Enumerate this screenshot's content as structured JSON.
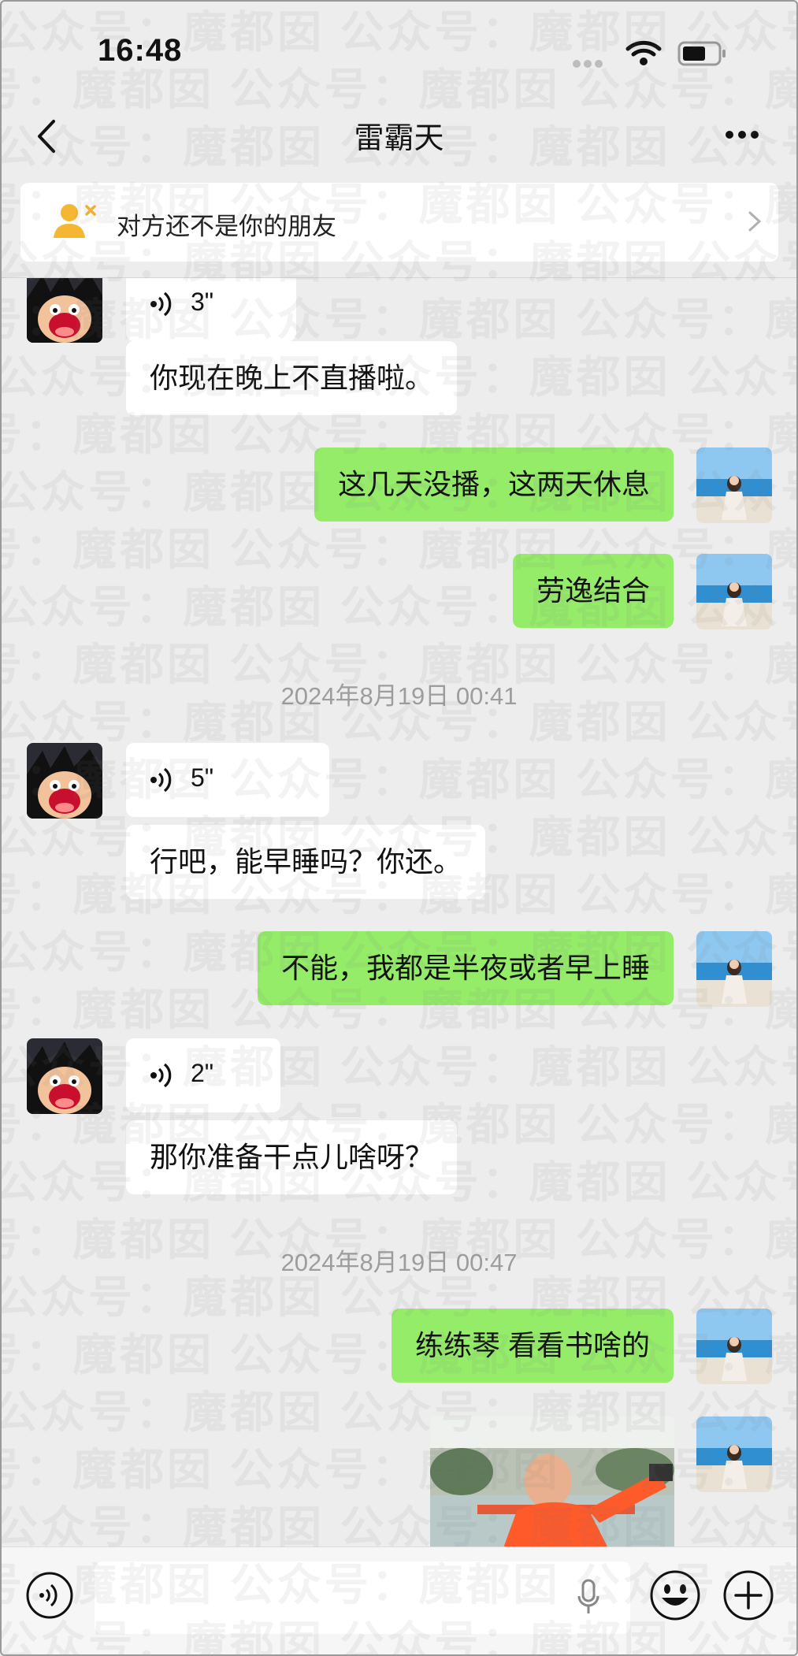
{
  "status_bar": {
    "time": "16:48"
  },
  "nav": {
    "title": "雷霸天"
  },
  "notice": {
    "text": "对方还不是你的朋友"
  },
  "messages": {
    "m1": {
      "duration": "3\""
    },
    "m2": {
      "text": "你现在晚上不直播啦。"
    },
    "m3": {
      "text": "这几天没播，这两天休息"
    },
    "m4": {
      "text": "劳逸结合"
    },
    "t1": {
      "text": "2024年8月19日 00:41"
    },
    "m5": {
      "duration": "5\""
    },
    "m6": {
      "text": "行吧，能早睡吗？你还。"
    },
    "m7": {
      "text": "不能，我都是半夜或者早上睡"
    },
    "m8": {
      "duration": "2\""
    },
    "m9": {
      "text": "那你准备干点儿啥呀？"
    },
    "t2": {
      "text": "2024年8月19日 00:47"
    },
    "m10": {
      "text": "练练琴 看看书啥的"
    }
  },
  "watermark": {
    "text": "公众号：魔都囡"
  },
  "colors": {
    "outgoing_bubble": "#95ec69",
    "incoming_bubble": "#ffffff",
    "background": "#ededed"
  },
  "icons": [
    "back-icon",
    "more-icon",
    "stranger-icon",
    "chevron-right-icon",
    "voice-wave-icon",
    "mic-icon",
    "emoji-icon",
    "plus-icon"
  ]
}
